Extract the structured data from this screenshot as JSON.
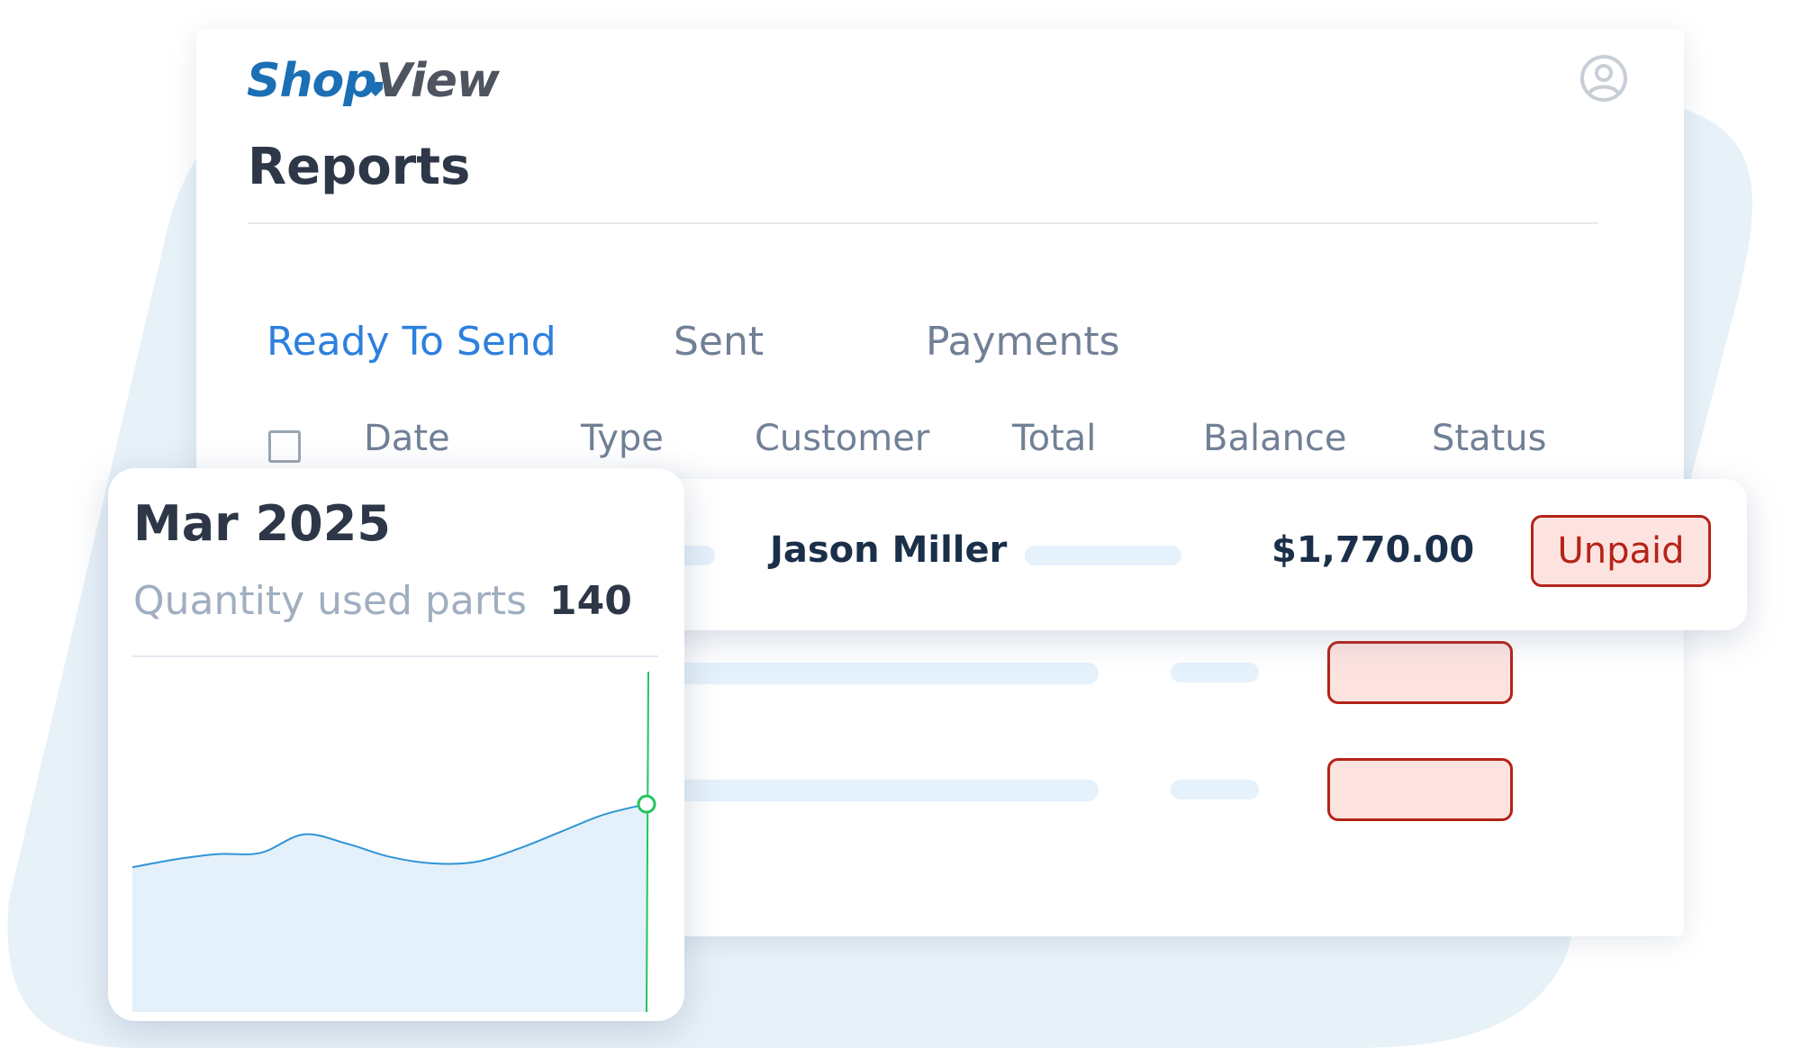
{
  "app": {
    "logo_part1": "Shop",
    "logo_part2": "View",
    "brand_color": "#1a6fb5"
  },
  "header": {
    "page_title": "Reports",
    "avatar_icon": "user-circle-icon"
  },
  "tabs": [
    {
      "label": "Ready To Send",
      "active": true
    },
    {
      "label": "Sent",
      "active": false
    },
    {
      "label": "Payments",
      "active": false
    }
  ],
  "table": {
    "columns": [
      "Date",
      "Type",
      "Customer",
      "Total",
      "Balance",
      "Status"
    ],
    "highlighted_row": {
      "customer": "Jason Miller",
      "balance": "$1,770.00",
      "status": "Unpaid"
    }
  },
  "colors": {
    "accent": "#2d80dd",
    "status_unpaid": "#b42318",
    "status_unpaid_bg": "#fde3e0",
    "chart_line": "#2f94d6",
    "chart_cursor": "#22c55e"
  },
  "chart_card": {
    "month": "Mar 2025",
    "label": "Quantity used parts",
    "value": "140"
  },
  "chart_data": {
    "type": "area",
    "title": "",
    "xlabel": "",
    "ylabel": "",
    "x": [
      0,
      1,
      2,
      3,
      4,
      5,
      6,
      7,
      8,
      9,
      10,
      11,
      12
    ],
    "values": [
      110,
      116,
      120,
      121,
      135,
      128,
      118,
      113,
      114,
      124,
      137,
      150,
      158
    ],
    "highlighted_index": 12,
    "grid": false
  }
}
